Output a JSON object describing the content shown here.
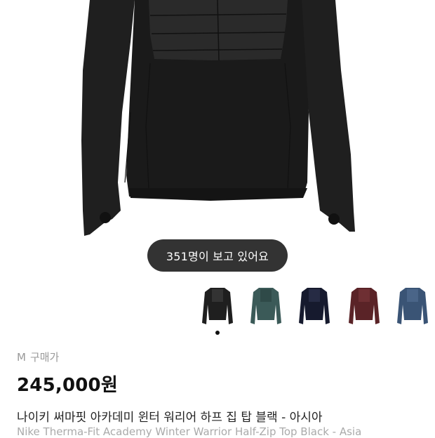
{
  "product": {
    "viewers_text": "351명이 보고 있어요",
    "size": "M",
    "price_label": "구매가",
    "price": "245,000원",
    "title_ko": "나이키 써마핏 아카데미 윈터 워리어 하프 집 탑 블랙 - 아시아",
    "title_en": "Nike Therma-Fit Academy Winter Warrior Half-Zip Top Black - Asia"
  },
  "thumbnails": [
    {
      "color_name": "black",
      "color": "#1f1f1f"
    },
    {
      "color_name": "dark-teal",
      "color": "#3b5a58"
    },
    {
      "color_name": "navy",
      "color": "#161a2e"
    },
    {
      "color_name": "burgundy",
      "color": "#5a2327"
    },
    {
      "color_name": "blue-grey",
      "color": "#3a5475"
    }
  ],
  "carousel": {
    "total_pages": 1,
    "current_page": 1
  },
  "colors": {
    "jacket": "#1c1c1c",
    "pill_bg": "#222222"
  }
}
